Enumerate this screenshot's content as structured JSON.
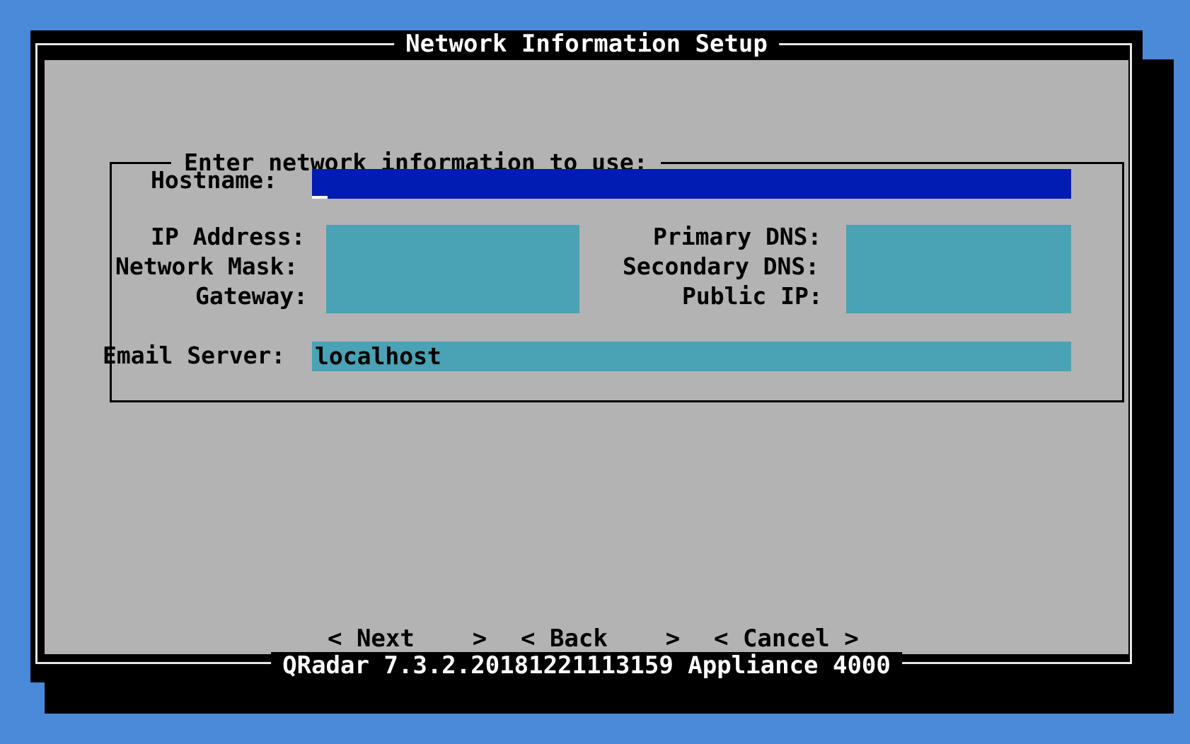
{
  "dialog": {
    "title": "Network Information Setup",
    "footer": "QRadar 7.3.2.20181221113159 Appliance 4000"
  },
  "group": {
    "label": "Enter network information to use:"
  },
  "fields": {
    "hostname": {
      "label": "Hostname:",
      "value": ""
    },
    "ip_address": {
      "label": "IP Address:",
      "value": ""
    },
    "network_mask": {
      "label": "Network Mask:",
      "value": ""
    },
    "gateway": {
      "label": "Gateway:",
      "value": ""
    },
    "primary_dns": {
      "label": "Primary DNS:",
      "value": ""
    },
    "secondary_dns": {
      "label": "Secondary DNS:",
      "value": ""
    },
    "public_ip": {
      "label": "Public IP:",
      "value": ""
    },
    "email_server": {
      "label": "Email Server:",
      "value": "localhost"
    }
  },
  "buttons": {
    "next": "< Next    >",
    "back": "< Back    >",
    "cancel": "< Cancel >"
  },
  "colors": {
    "desktop": "#4a8ad8",
    "dialog_bg": "#b3b3b3",
    "field_bg": "#4aa2b5",
    "focused_field_bg": "#001cb3"
  }
}
